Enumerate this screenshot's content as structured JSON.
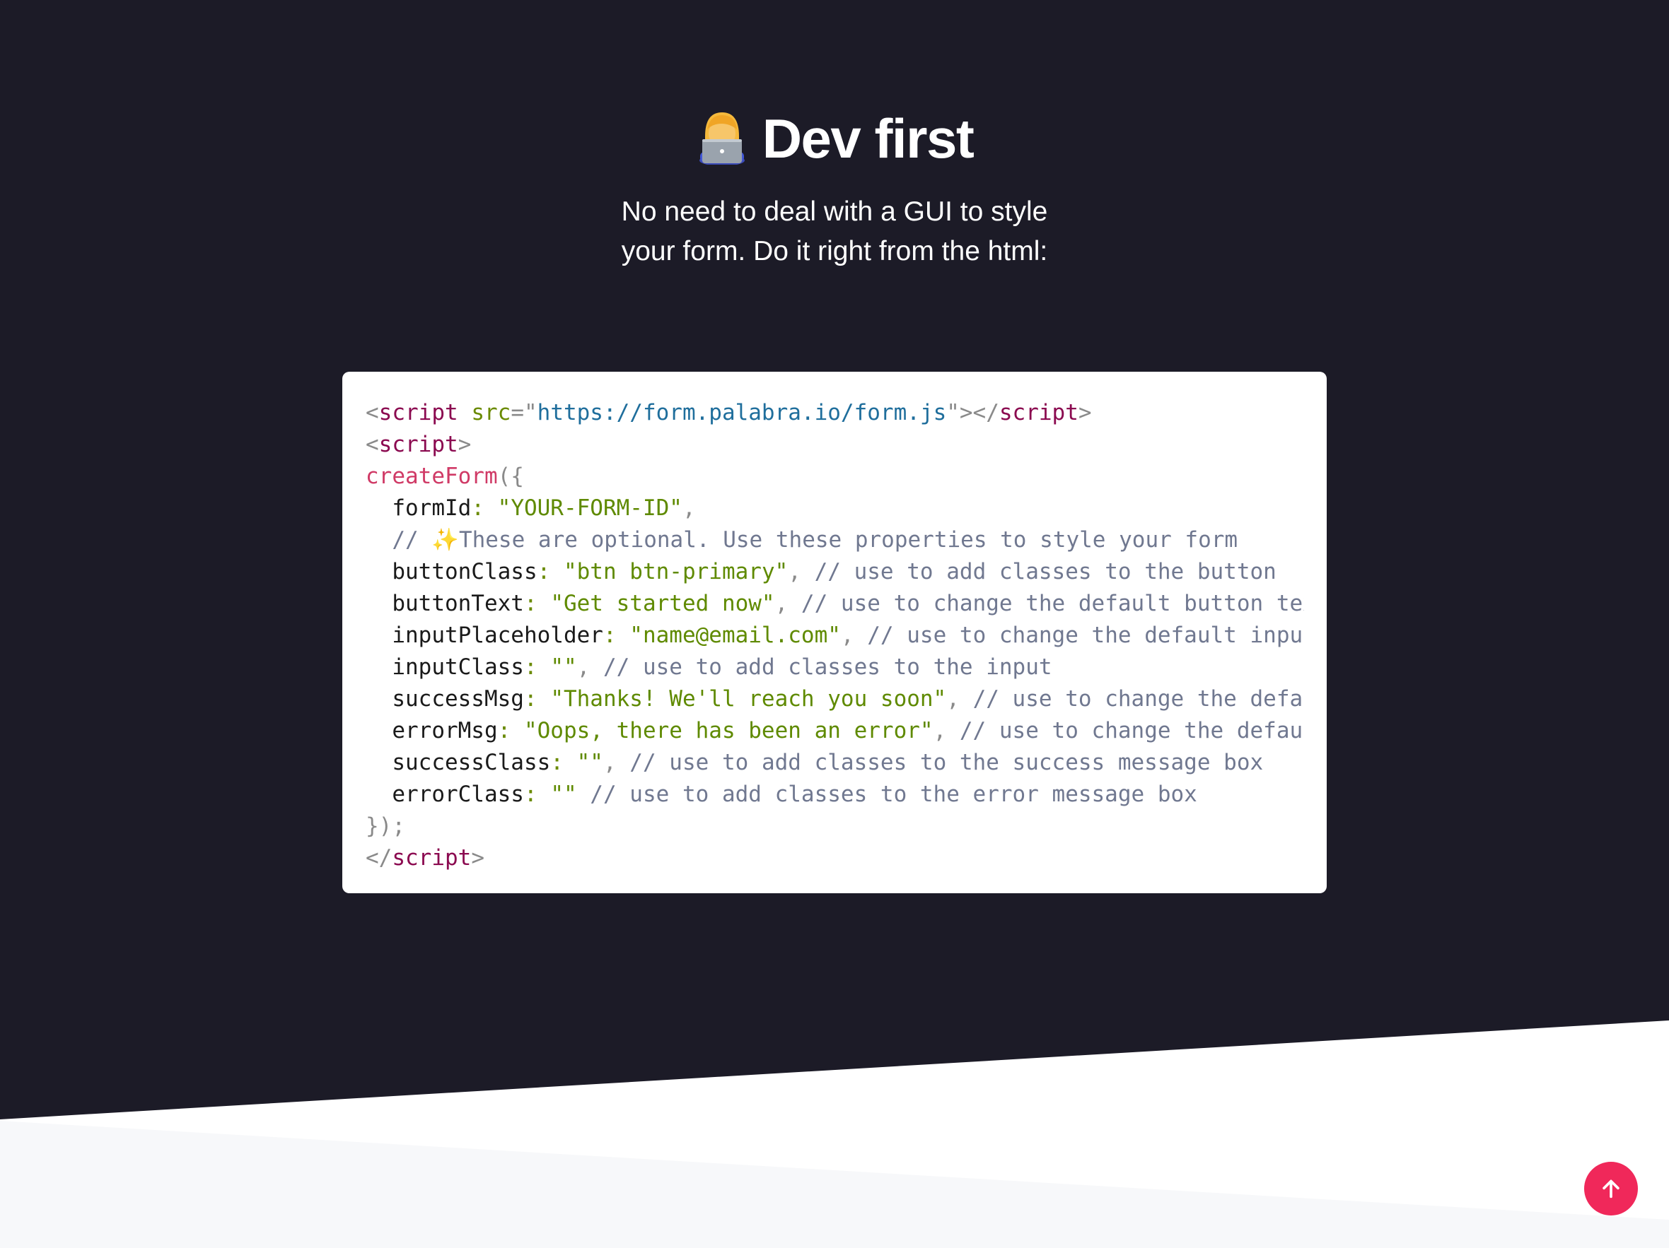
{
  "hero": {
    "emoji_name": "technologist-emoji",
    "title": "Dev first",
    "subtitle_line1": "No need to deal with a GUI to style",
    "subtitle_line2": "your form. Do it right from the html:"
  },
  "code": {
    "line1": {
      "open_lt": "<",
      "tag": "script",
      "sp": " ",
      "attr": "src",
      "eq": "=\"",
      "url": "https://form.palabra.io/form.js",
      "close": "\"></",
      "tag2": "script",
      "gt": ">"
    },
    "line2": {
      "lt": "<",
      "tag": "script",
      "gt": ">"
    },
    "line3": {
      "fn": "createForm",
      "punct": "({"
    },
    "line4": {
      "indent": "  ",
      "prop": "formId",
      "colon": ":",
      "sp": " ",
      "str": "\"YOUR-FORM-ID\"",
      "comma": ","
    },
    "line5": {
      "indent": "  ",
      "cmt_start": "// ",
      "spark": "✨",
      "cmt": "These are optional. Use these properties to style your form"
    },
    "line6": {
      "indent": "  ",
      "prop": "buttonClass",
      "colon": ":",
      "sp": " ",
      "str": "\"btn btn-primary\"",
      "comma": ",",
      "cmt": " // use to add classes to the button"
    },
    "line7": {
      "indent": "  ",
      "prop": "buttonText",
      "colon": ":",
      "sp": " ",
      "str": "\"Get started now\"",
      "comma": ",",
      "cmt": " // use to change the default button text"
    },
    "line8": {
      "indent": "  ",
      "prop": "inputPlaceholder",
      "colon": ":",
      "sp": " ",
      "str": "\"name@email.com\"",
      "comma": ",",
      "cmt": " // use to change the default input's plac"
    },
    "line9": {
      "indent": "  ",
      "prop": "inputClass",
      "colon": ":",
      "sp": " ",
      "str": "\"\"",
      "comma": ",",
      "cmt": " // use to add classes to the input"
    },
    "line10": {
      "indent": "  ",
      "prop": "successMsg",
      "colon": ":",
      "sp": " ",
      "str": "\"Thanks! We'll reach you soon\"",
      "comma": ",",
      "cmt": " // use to change the default succ"
    },
    "line11": {
      "indent": "  ",
      "prop": "errorMsg",
      "colon": ":",
      "sp": " ",
      "str": "\"Oops, there has been an error\"",
      "comma": ",",
      "cmt": " // use to change the default error"
    },
    "line12": {
      "indent": "  ",
      "prop": "successClass",
      "colon": ":",
      "sp": " ",
      "str": "\"\"",
      "comma": ",",
      "cmt": " // use to add classes to the success message box"
    },
    "line13": {
      "indent": "  ",
      "prop": "errorClass",
      "colon": ":",
      "sp": " ",
      "str": "\"\"",
      "cmt": " // use to add classes to the error message box"
    },
    "line14": {
      "punct": "});"
    },
    "line15": {
      "lt": "</",
      "tag": "script",
      "gt": ">"
    }
  },
  "scroll_top": {
    "icon": "arrow-up-icon"
  },
  "colors": {
    "background": "#1c1b27",
    "card": "#ffffff",
    "accent": "#f0285a",
    "footer": "#f7f8fa"
  }
}
